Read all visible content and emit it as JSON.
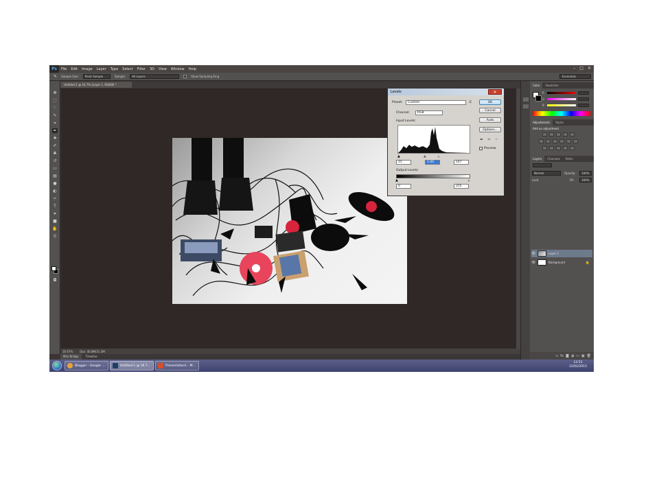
{
  "menubar": {
    "logo": "Ps",
    "items": [
      "File",
      "Edit",
      "Image",
      "Layer",
      "Type",
      "Select",
      "Filter",
      "3D",
      "View",
      "Window",
      "Help"
    ],
    "window_controls": [
      "–",
      "□",
      "✕"
    ]
  },
  "options_bar": {
    "sample_size_label": "Sample Size:",
    "sample_size_value": "Point Sample",
    "sample_label": "Sample:",
    "sample_value": "All Layers",
    "show_ring_label": "Show Sampling Ring",
    "workspace": "Essentials"
  },
  "document_tab": {
    "title": "Untitled-1 @ 16.7% (Layer 1, RGB/8) *"
  },
  "status_bar": {
    "zoom": "16.67%",
    "doc": "Doc: 40.8M/31.3M"
  },
  "bottom_tabs": [
    "Mini Bridge",
    "Timeline"
  ],
  "levels_dialog": {
    "title": "Levels",
    "close": "✕",
    "preset_label": "Preset:",
    "preset_value": "Custom",
    "channel_label": "Channel:",
    "channel_value": "RGB",
    "input_levels_label": "Input Levels:",
    "input_black": "15",
    "input_gamma": "1.00",
    "input_white": "147",
    "output_levels_label": "Output Levels:",
    "output_black": "0",
    "output_white": "255",
    "buttons": {
      "ok": "OK",
      "cancel": "Cancel",
      "auto": "Auto",
      "options": "Options..."
    },
    "preview_label": "Preview",
    "preview_checked": true
  },
  "color_panel": {
    "tabs": [
      "Color",
      "Swatches"
    ],
    "fg_color": "#ffffff",
    "bg_color": "#000000"
  },
  "adjustments_panel": {
    "tabs": [
      "Adjustments",
      "Styles"
    ],
    "heading": "Add an adjustment"
  },
  "layers_panel": {
    "tabs": [
      "Layers",
      "Channels",
      "Paths"
    ],
    "blend_mode": "Normal",
    "opacity_label": "Opacity:",
    "opacity_value": "100%",
    "lock_label": "Lock:",
    "fill_label": "Fill:",
    "fill_value": "100%",
    "layers": [
      {
        "name": "Layer 1",
        "selected": true
      },
      {
        "name": "Background",
        "selected": false
      }
    ],
    "footer_icons": [
      "link-icon",
      "fx-icon",
      "mask-icon",
      "adjustment-icon",
      "folder-icon",
      "new-layer-icon",
      "trash-icon"
    ]
  },
  "taskbar": {
    "items": [
      {
        "label": "Blogger - Google ...",
        "icon_color": "#e8a33a"
      },
      {
        "label": "Untitled-1 @ 16.7...",
        "icon_color": "#1f3f66"
      },
      {
        "label": "Presentation1 - M...",
        "icon_color": "#d2502e"
      }
    ],
    "time": "13:53",
    "date": "12/02/2015"
  },
  "colors": {
    "screen_bg": "#3b3433",
    "panel_bg": "#535050",
    "accent_selection": "#6d7a8c"
  }
}
